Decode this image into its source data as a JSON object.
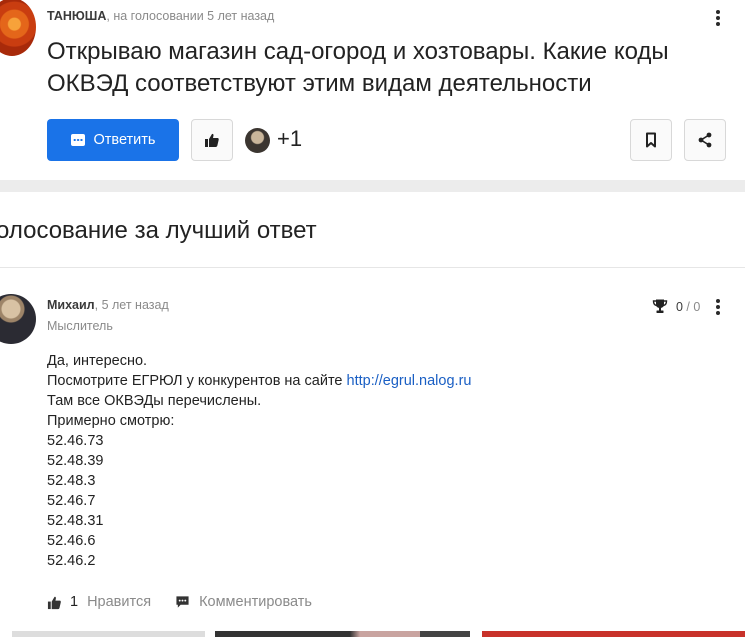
{
  "question": {
    "author": "ТАНЮША",
    "meta": ", на голосовании 5 лет назад",
    "title": "Открываю магазин сад-огород и хозтовары. Какие коды ОКВЭД соответствуют этим видам деятельности"
  },
  "toolbar": {
    "answer_label": "Ответить",
    "participants_count": "+1"
  },
  "section": {
    "title": "олосование за лучший ответ"
  },
  "answer": {
    "author": "Михаил",
    "time": ", 5 лет назад",
    "rank": "Мыслитель",
    "score_value": "0",
    "score_sep": " / ",
    "score_total": "0",
    "line1": "Да, интересно.",
    "line2_prefix": "Посмотрите ЕГРЮЛ у конкурентов на сайте ",
    "link": "http://egrul.nalog.ru",
    "line3": "Там все ОКВЭДы перечислены.",
    "line4": "Примерно смотрю:",
    "codes": [
      "52.46.73",
      "52.48.39",
      "52.48.3",
      "52.46.7",
      "52.48.31",
      "52.46.6",
      "52.46.2"
    ],
    "likes_count": "1",
    "like_label": "Нравится",
    "comment_label": "Комментировать"
  },
  "colors": {
    "accent": "#1a73e8",
    "link": "#1a5fc4",
    "muted": "#8a8a8a"
  },
  "icons": [
    "kebab-icon",
    "chat-icon",
    "thumbs-up-icon",
    "bookmark-icon",
    "share-icon",
    "trophy-icon",
    "comment-icon"
  ]
}
